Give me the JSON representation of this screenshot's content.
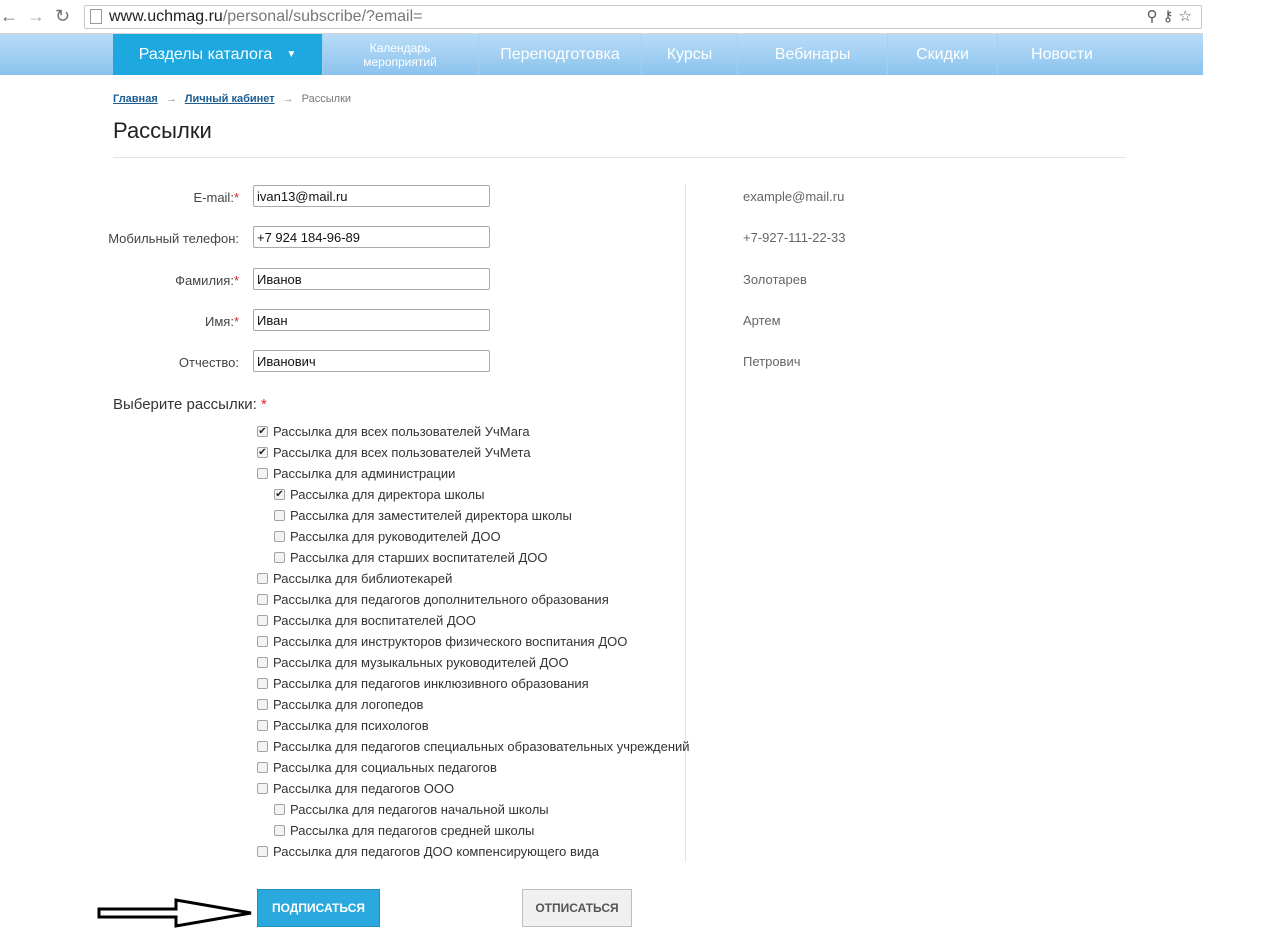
{
  "browser": {
    "url_host": "www.uchmag.ru",
    "url_path": "/personal/subscribe/?email=",
    "back_icon": "back-arrow-icon",
    "forward_icon": "forward-arrow-icon",
    "reload_icon": "reload-icon"
  },
  "nav": {
    "catalog": "Разделы каталога",
    "calendar": "Календарь мероприятий",
    "retraining": "Переподготовка",
    "courses": "Курсы",
    "webinars": "Вебинары",
    "discounts": "Скидки",
    "news": "Новости",
    "active_color": "#1ea8e0"
  },
  "breadcrumb": {
    "home": "Главная",
    "cabinet": "Личный кабинет",
    "current": "Рассылки",
    "separator": "→"
  },
  "page_title": "Рассылки",
  "form": {
    "email": {
      "label": "E-mail:",
      "required": "*",
      "value": "ivan13@mail.ru",
      "hint": "example@mail.ru"
    },
    "phone": {
      "label": "Мобильный телефон:",
      "value": "+7 924 184-96-89",
      "hint": "+7-927-111-22-33"
    },
    "lastname": {
      "label": "Фамилия:",
      "required": "*",
      "value": "Иванов",
      "hint": "Золотарев"
    },
    "firstname": {
      "label": "Имя:",
      "required": "*",
      "value": "Иван",
      "hint": "Артем"
    },
    "middlename": {
      "label": "Отчество:",
      "value": "Иванович",
      "hint": "Петрович"
    }
  },
  "subscriptions": {
    "title": "Выберите рассылки:",
    "required": "*",
    "items": [
      {
        "label": "Рассылка для всех пользователей УчМага",
        "checked": true,
        "indent": 0
      },
      {
        "label": "Рассылка для всех пользователей УчМета",
        "checked": true,
        "indent": 0
      },
      {
        "label": "Рассылка для администрации",
        "checked": false,
        "indent": 0
      },
      {
        "label": "Рассылка для директора школы",
        "checked": true,
        "indent": 1
      },
      {
        "label": "Рассылка для заместителей директора школы",
        "checked": false,
        "indent": 1
      },
      {
        "label": "Рассылка для руководителей ДОО",
        "checked": false,
        "indent": 1
      },
      {
        "label": "Рассылка для старших воспитателей ДОО",
        "checked": false,
        "indent": 1
      },
      {
        "label": "Рассылка для библиотекарей",
        "checked": false,
        "indent": 0
      },
      {
        "label": "Рассылка для педагогов дополнительного образования",
        "checked": false,
        "indent": 0
      },
      {
        "label": "Рассылка для воспитателей ДОО",
        "checked": false,
        "indent": 0
      },
      {
        "label": "Рассылка для инструкторов физического воспитания ДОО",
        "checked": false,
        "indent": 0
      },
      {
        "label": "Рассылка для музыкальных руководителей ДОО",
        "checked": false,
        "indent": 0
      },
      {
        "label": "Рассылка для педагогов инклюзивного образования",
        "checked": false,
        "indent": 0
      },
      {
        "label": "Рассылка для логопедов",
        "checked": false,
        "indent": 0
      },
      {
        "label": "Рассылка для психологов",
        "checked": false,
        "indent": 0
      },
      {
        "label": "Рассылка для педагогов специальных образовательных учреждений",
        "checked": false,
        "indent": 0
      },
      {
        "label": "Рассылка для социальных педагогов",
        "checked": false,
        "indent": 0
      },
      {
        "label": "Рассылка для педагогов ООО",
        "checked": false,
        "indent": 0
      },
      {
        "label": "Рассылка для педагогов начальной школы",
        "checked": false,
        "indent": 1
      },
      {
        "label": "Рассылка для педагогов средней школы",
        "checked": false,
        "indent": 1
      },
      {
        "label": "Рассылка для педагогов ДОО компенсирующего вида",
        "checked": false,
        "indent": 0
      }
    ]
  },
  "buttons": {
    "subscribe": "ПОДПИСАТЬСЯ",
    "unsubscribe": "ОТПИСАТЬСЯ"
  }
}
